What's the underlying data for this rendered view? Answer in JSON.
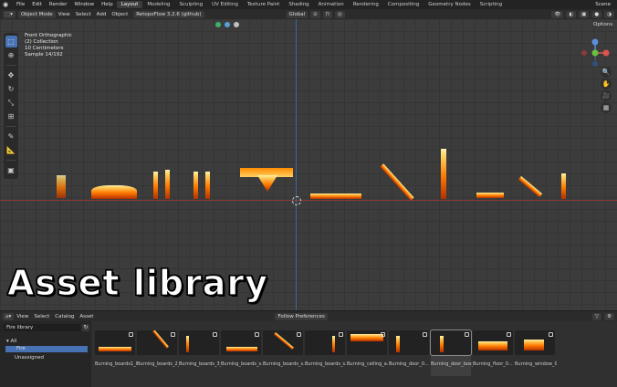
{
  "topbar": {
    "menus": [
      "File",
      "Edit",
      "Render",
      "Window",
      "Help"
    ],
    "workspaces": [
      "Layout",
      "Modeling",
      "Sculpting",
      "UV Editing",
      "Texture Paint",
      "Shading",
      "Animation",
      "Rendering",
      "Compositing",
      "Geometry Nodes",
      "Scripting"
    ],
    "active_workspace": "Layout",
    "scene": "Scene"
  },
  "header": {
    "mode": "Object Mode",
    "menus": [
      "View",
      "Select",
      "Add",
      "Object"
    ],
    "addon": "RetopoFlow 3.2.6 (github)",
    "orientation": "Global",
    "options": "Options"
  },
  "viewport": {
    "info": [
      "Front Orthographic",
      "(2) Collection",
      "10 Centimeters",
      "Sample 14/192"
    ]
  },
  "overlay_title": "Asset library",
  "asset_browser": {
    "menus": [
      "View",
      "Select",
      "Catalog",
      "Asset"
    ],
    "import": "Follow Preferences",
    "library": "Fire library",
    "tree": {
      "all": "All",
      "fire": "Fire",
      "unassigned": "Unassigned"
    },
    "assets": [
      "Burning_boards1_0...",
      "Burning_boards_2_0...",
      "Burning_boards_3_0...",
      "Burning_boards_s...",
      "Burning_boards_s...",
      "Burning_boards_s...",
      "Burning_ceiling_a...",
      "Burning_door_0...",
      "Burning_door_box_0...",
      "Burning_floor_0...",
      "Burning_window_0..."
    ]
  },
  "colors": {
    "accent": "#4772b3",
    "fire": "#ff7a00"
  }
}
